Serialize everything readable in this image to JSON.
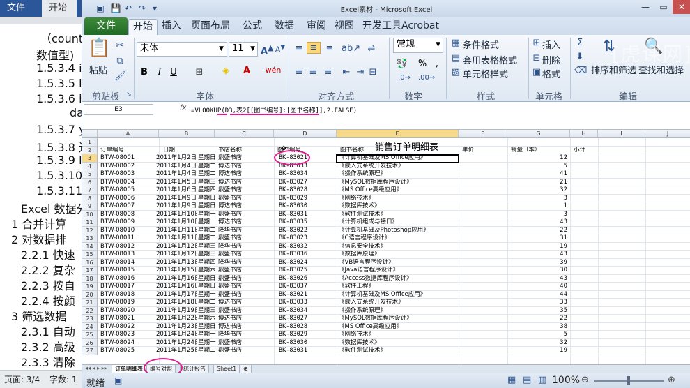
{
  "word": {
    "file_tab": "文件",
    "home_tab": "开始",
    "lines": [
      "（count(",
      "数值型)",
      "1.5.3.4 if",
      "1.5.3.5 le",
      "1.5.3.6 in",
      "da",
      "1.5.3.7 ye",
      "1.5.3.8 逻",
      "1.5.3.9 lfe",
      "1.5.3.10",
      "1.5.3.11",
      "Excel 数据分",
      "1   合并计算",
      "2   对数据排",
      "2.2.1 快速",
      "2.2.2 复杂",
      "2.2.3 按自",
      "2.2.4 按颜",
      "3   筛选数据",
      "2.3.1 自动",
      "2.3.2 高级",
      "2.3.3 清除"
    ],
    "status_page": "页面: 3/4",
    "status_words": "字数: 1"
  },
  "excel": {
    "window_title": "Excel素材 - Microsoft Excel",
    "watermark": "[虎课网]",
    "tabs": [
      "文件",
      "开始",
      "插入",
      "页面布局",
      "公式",
      "数据",
      "审阅",
      "视图",
      "开发工具",
      "Acrobat"
    ],
    "ribbon": {
      "paste": "粘贴",
      "clipboard": "剪贴板",
      "font_name": "宋体",
      "font_size": "11",
      "font_group": "字体",
      "align_group": "对齐方式",
      "number_format": "常规",
      "number_group": "数字",
      "cond_format": "条件格式",
      "table_format": "套用表格格式",
      "cell_style": "单元格样式",
      "style_group": "样式",
      "insert": "插入",
      "delete": "删除",
      "format": "格式",
      "cells_group": "单元格",
      "sort_filter": "排序和筛选",
      "find_select": "查找和选择",
      "edit_group": "编辑"
    },
    "name_box": "E3",
    "fx": "fx",
    "formula": "=VLOOKUP(D3,表2[[图书编号]:[图书名称]],2,FALSE)",
    "columns": [
      "A",
      "B",
      "C",
      "D",
      "E",
      "F",
      "G",
      "H",
      "I",
      "J"
    ],
    "sheet_title": "销售订单明细表",
    "headers": [
      "订单编号",
      "日期",
      "书店名称",
      "图书编号",
      "图书名称",
      "单价",
      "销量（本）",
      "小计"
    ],
    "rows": [
      [
        "BTW-08001",
        "2011年1月2日",
        "星期日",
        "鼎盛书店",
        "BK-83021",
        "《计算机基础及MS Office应用》",
        "12"
      ],
      [
        "BTW-08002",
        "2011年1月4日",
        "星期二",
        "博达书店",
        "BK-83033",
        "《嵌入式系统开发技术》",
        "5"
      ],
      [
        "BTW-08003",
        "2011年1月4日",
        "星期二",
        "博达书店",
        "BK-83034",
        "《操作系统原理》",
        "41"
      ],
      [
        "BTW-08004",
        "2011年1月5日",
        "星期三",
        "博达书店",
        "BK-83027",
        "《MySQL数据库程序设计》",
        "21"
      ],
      [
        "BTW-08005",
        "2011年1月6日",
        "星期四",
        "鼎盛书店",
        "BK-83028",
        "《MS Office高级应用》",
        "32"
      ],
      [
        "BTW-08006",
        "2011年1月9日",
        "星期日",
        "鼎盛书店",
        "BK-83029",
        "《网络技术》",
        "3"
      ],
      [
        "BTW-08007",
        "2011年1月9日",
        "星期日",
        "博达书店",
        "BK-83030",
        "《数据库技术》",
        "1"
      ],
      [
        "BTW-08008",
        "2011年1月10日",
        "星期一",
        "鼎盛书店",
        "BK-83031",
        "《软件测试技术》",
        "3"
      ],
      [
        "BTW-08009",
        "2011年1月10日",
        "星期一",
        "博达书店",
        "BK-83035",
        "《计算机组成与接口》",
        "43"
      ],
      [
        "BTW-08010",
        "2011年1月11日",
        "星期二",
        "隆华书店",
        "BK-83022",
        "《计算机基础及Photoshop应用》",
        "22"
      ],
      [
        "BTW-08011",
        "2011年1月11日",
        "星期二",
        "鼎盛书店",
        "BK-83023",
        "《C语言程序设计》",
        "31"
      ],
      [
        "BTW-08012",
        "2011年1月12日",
        "星期三",
        "隆华书店",
        "BK-83032",
        "《信息安全技术》",
        "19"
      ],
      [
        "BTW-08013",
        "2011年1月12日",
        "星期三",
        "鼎盛书店",
        "BK-83036",
        "《数据库原理》",
        "43"
      ],
      [
        "BTW-08014",
        "2011年1月13日",
        "星期四",
        "隆华书店",
        "BK-83024",
        "《VB语言程序设计》",
        "39"
      ],
      [
        "BTW-08015",
        "2011年1月15日",
        "星期六",
        "鼎盛书店",
        "BK-83025",
        "《Java语言程序设计》",
        "30"
      ],
      [
        "BTW-08016",
        "2011年1月16日",
        "星期日",
        "鼎盛书店",
        "BK-83026",
        "《Access数据库程序设计》",
        "43"
      ],
      [
        "BTW-08017",
        "2011年1月16日",
        "星期日",
        "鼎盛书店",
        "BK-83037",
        "《软件工程》",
        "40"
      ],
      [
        "BTW-08018",
        "2011年1月17日",
        "星期一",
        "鼎盛书店",
        "BK-83021",
        "《计算机基础及MS Office应用》",
        "44"
      ],
      [
        "BTW-08019",
        "2011年1月18日",
        "星期二",
        "博达书店",
        "BK-83033",
        "《嵌入式系统开发技术》",
        "33"
      ],
      [
        "BTW-08020",
        "2011年1月19日",
        "星期三",
        "鼎盛书店",
        "BK-83034",
        "《操作系统原理》",
        "35"
      ],
      [
        "BTW-08021",
        "2011年1月22日",
        "星期六",
        "博达书店",
        "BK-83027",
        "《MySQL数据库程序设计》",
        "22"
      ],
      [
        "BTW-08022",
        "2011年1月23日",
        "星期日",
        "博达书店",
        "BK-83028",
        "《MS Office高级应用》",
        "38"
      ],
      [
        "BTW-08023",
        "2011年1月24日",
        "星期一",
        "隆华书店",
        "BK-83029",
        "《网络技术》",
        "5"
      ],
      [
        "BTW-08024",
        "2011年1月24日",
        "星期一",
        "鼎盛书店",
        "BK-83030",
        "《数据库技术》",
        "32"
      ],
      [
        "BTW-08025",
        "2011年1月25日",
        "星期二",
        "鼎盛书店",
        "BK-83031",
        "《软件测试技术》",
        "19"
      ]
    ],
    "row_numbers": [
      "1",
      "2",
      "3",
      "4",
      "5",
      "6",
      "7",
      "8",
      "9",
      "10",
      "11",
      "12",
      "13",
      "14",
      "15",
      "16",
      "17",
      "18",
      "19",
      "20",
      "21",
      "22",
      "23",
      "24",
      "25",
      "26",
      "27"
    ],
    "sheet_tabs": [
      "订单明细表",
      "编号对照",
      "统计报告",
      "Sheet1"
    ],
    "status_ready": "就绪",
    "zoom": "100%"
  }
}
